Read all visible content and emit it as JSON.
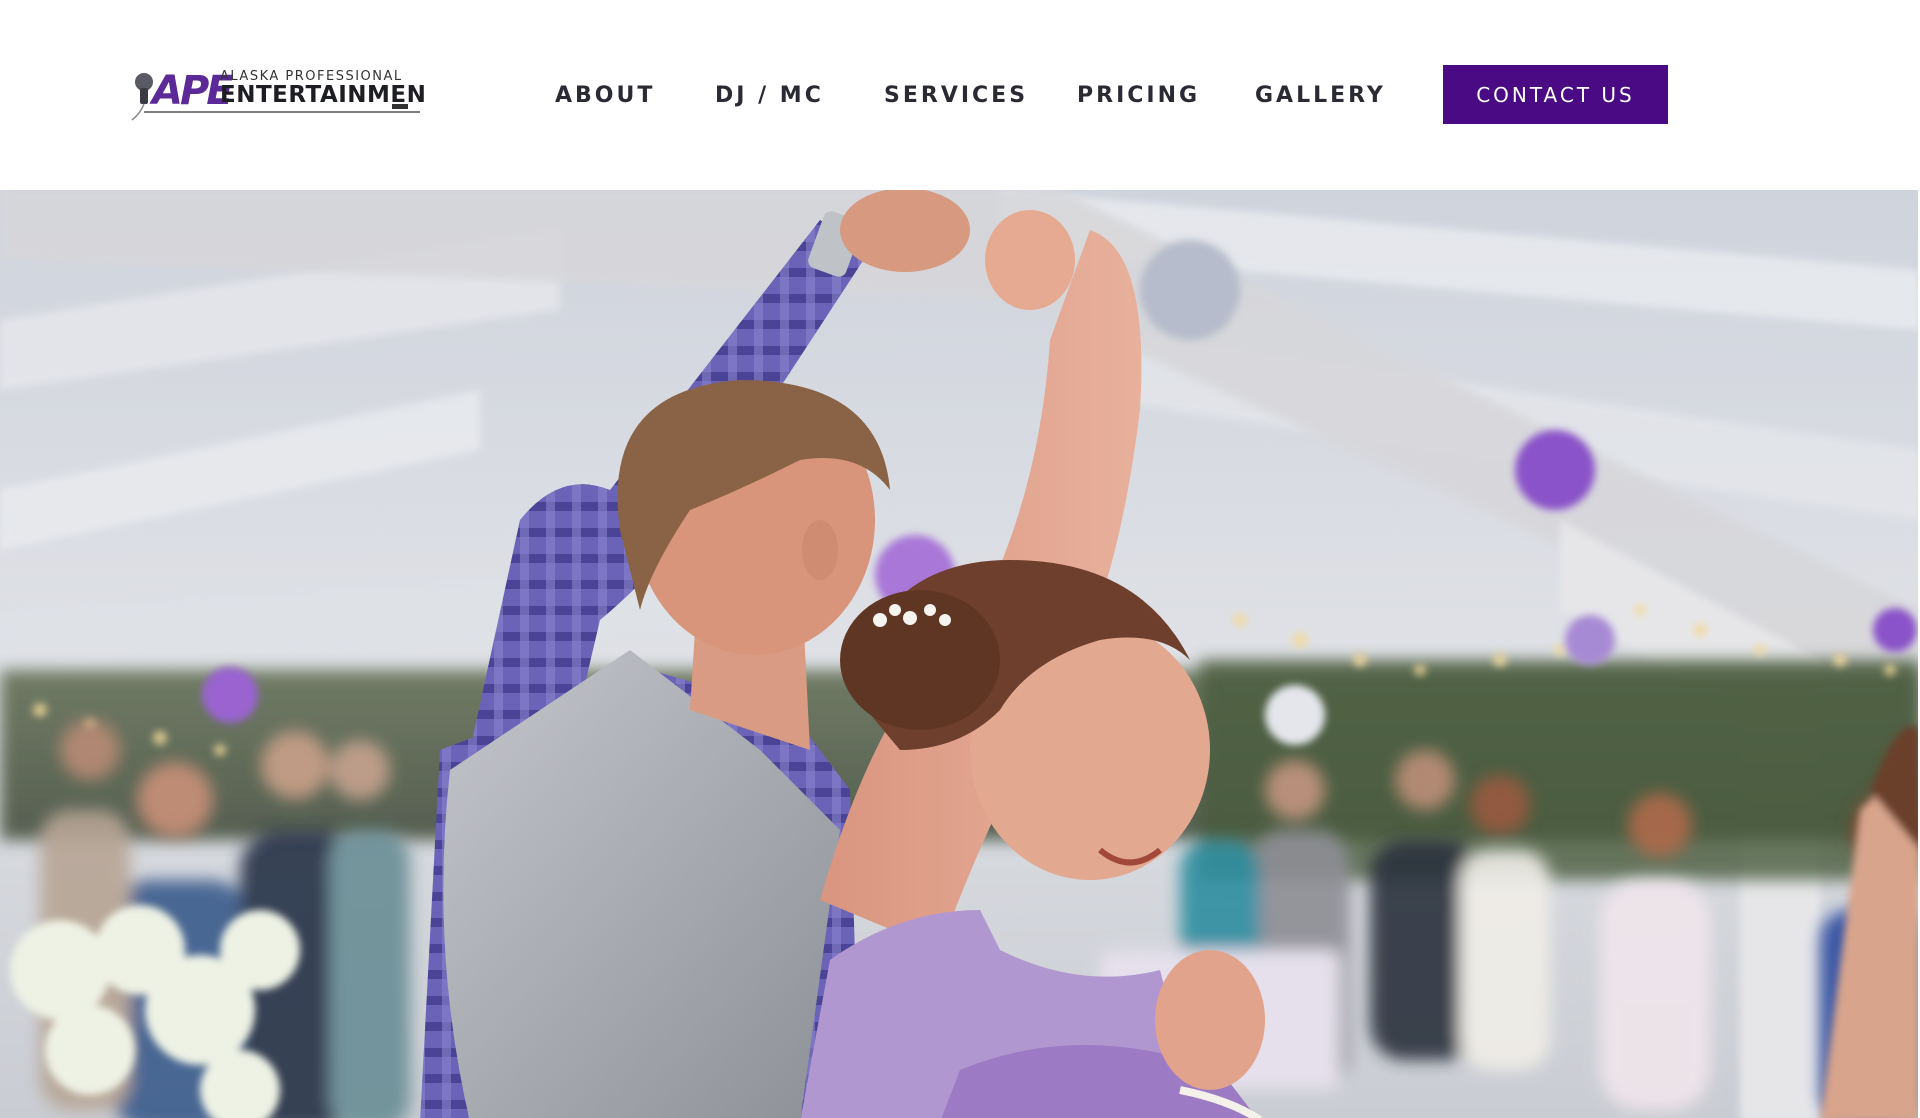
{
  "header": {
    "logo": {
      "mark": "APE",
      "line1": "ALASKA PROFESSIONAL",
      "line2": "ENTERTAINMENT"
    },
    "nav": [
      {
        "label": "ABOUT"
      },
      {
        "label": "DJ / MC"
      },
      {
        "label": "SERVICES"
      },
      {
        "label": "PRICING"
      },
      {
        "label": "GALLERY"
      }
    ],
    "cta_label": "CONTACT US"
  },
  "colors": {
    "brand_purple": "#4a0a84",
    "nav_text": "#2a2a35",
    "background": "#ffffff"
  },
  "hero": {
    "image": "wedding-dance-photo"
  }
}
